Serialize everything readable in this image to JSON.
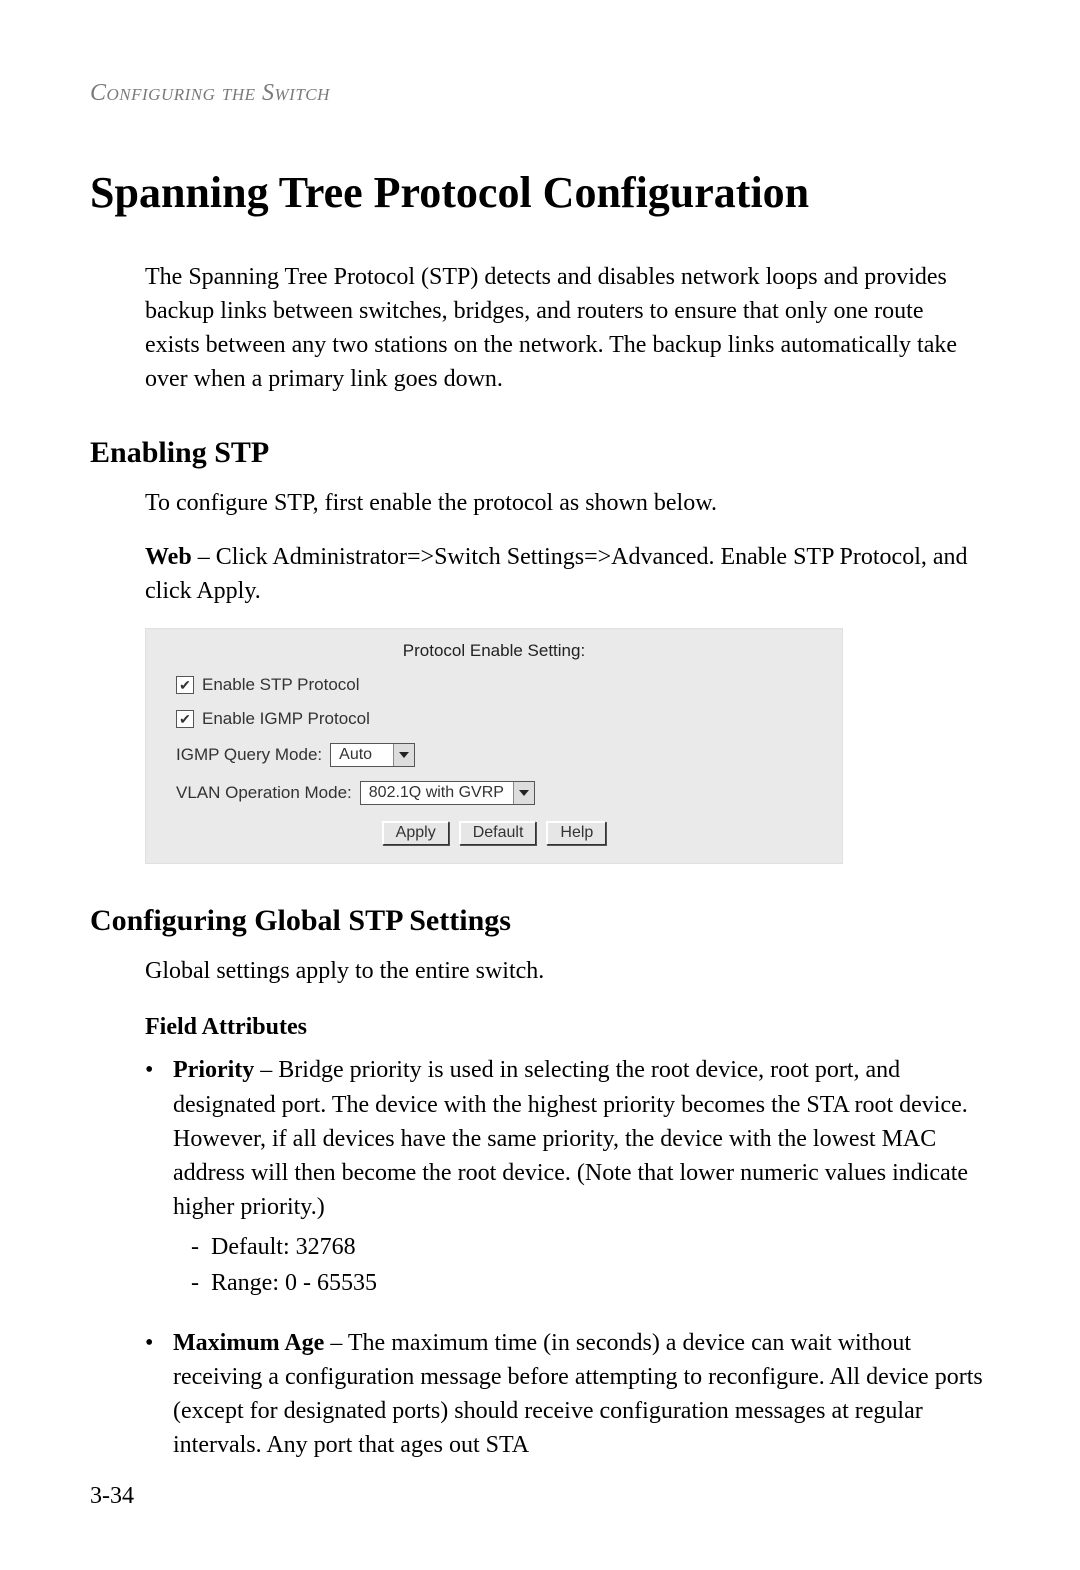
{
  "header": {
    "running_head": "Configuring the Switch"
  },
  "title": "Spanning Tree Protocol Configuration",
  "intro_paragraph": "The Spanning Tree Protocol (STP) detects and disables network loops and provides backup links between switches, bridges, and routers to ensure that only one route exists between any two stations on the network. The backup links automatically take over when a primary link goes down.",
  "section_enable": {
    "heading": "Enabling STP",
    "p1": "To configure STP, first enable the protocol as shown below.",
    "web_line_bold": "Web",
    "web_line_rest": " – Click Administrator=>Switch Settings=>Advanced. Enable STP Protocol, and click Apply."
  },
  "ui": {
    "title": "Protocol Enable Setting:",
    "stp_checkbox_checked": true,
    "stp_label": "Enable STP Protocol",
    "igmp_checkbox_checked": true,
    "igmp_label": "Enable IGMP Protocol",
    "igmp_query_label": "IGMP Query Mode:",
    "igmp_query_value": "Auto",
    "vlan_label": "VLAN Operation Mode:",
    "vlan_value": "802.1Q with GVRP",
    "buttons": {
      "apply": "Apply",
      "default": "Default",
      "help": "Help"
    }
  },
  "section_global": {
    "heading": "Configuring Global STP Settings",
    "intro": "Global settings apply to the entire switch.",
    "field_attr_heading": "Field Attributes",
    "priority": {
      "term": "Priority",
      "desc": " – Bridge priority is used in selecting the root device, root port, and designated port. The device with the highest priority becomes the STA root device. However, if all devices have the same priority, the device with the lowest MAC address will then become the root device. (Note that lower numeric values indicate higher priority.)",
      "sub_default": "Default: 32768",
      "sub_range": "Range: 0 - 65535"
    },
    "max_age": {
      "term": "Maximum Age",
      "desc": " – The maximum time (in seconds) a device can wait without receiving a configuration message before attempting to reconfigure. All device ports (except for designated ports) should receive configuration messages at regular intervals. Any port that ages out STA"
    }
  },
  "page_number": "3-34"
}
